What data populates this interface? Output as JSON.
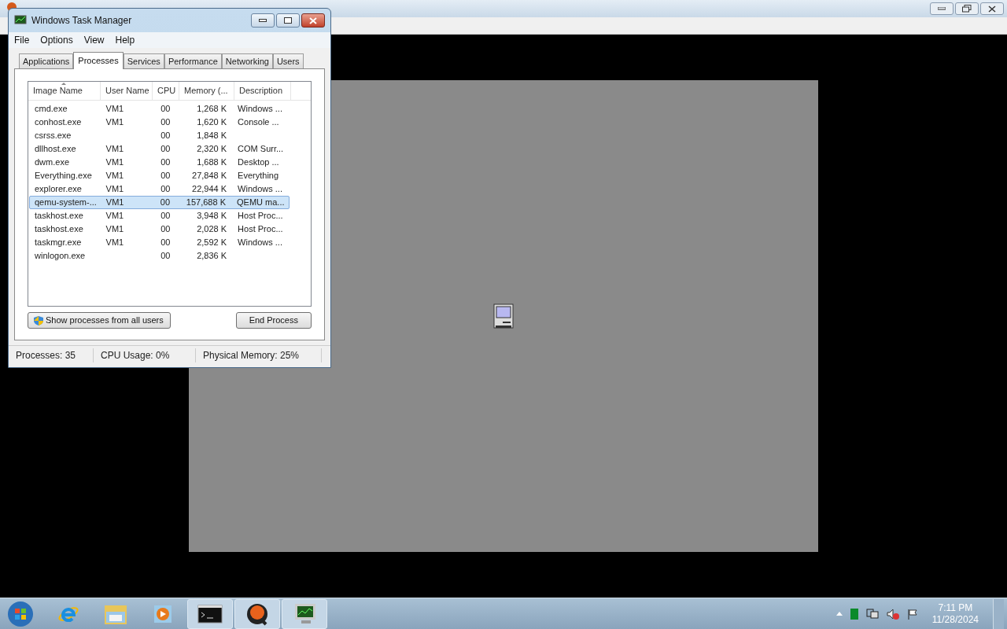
{
  "task_manager": {
    "title": "Windows Task Manager",
    "menu": [
      "File",
      "Options",
      "View",
      "Help"
    ],
    "tabs": [
      {
        "label": "Applications",
        "selected": false
      },
      {
        "label": "Processes",
        "selected": true
      },
      {
        "label": "Services",
        "selected": false
      },
      {
        "label": "Performance",
        "selected": false
      },
      {
        "label": "Networking",
        "selected": false
      },
      {
        "label": "Users",
        "selected": false
      }
    ],
    "columns": [
      "Image Name",
      "User Name",
      "CPU",
      "Memory (...",
      "Description"
    ],
    "rows": [
      {
        "cells": [
          "cmd.exe",
          "VM1",
          "00",
          "1,268 K",
          "Windows ..."
        ],
        "selected": false
      },
      {
        "cells": [
          "conhost.exe",
          "VM1",
          "00",
          "1,620 K",
          "Console ..."
        ],
        "selected": false
      },
      {
        "cells": [
          "csrss.exe",
          "",
          "00",
          "1,848 K",
          ""
        ],
        "selected": false
      },
      {
        "cells": [
          "dllhost.exe",
          "VM1",
          "00",
          "2,320 K",
          "COM Surr..."
        ],
        "selected": false
      },
      {
        "cells": [
          "dwm.exe",
          "VM1",
          "00",
          "1,688 K",
          "Desktop ..."
        ],
        "selected": false
      },
      {
        "cells": [
          "Everything.exe",
          "VM1",
          "00",
          "27,848 K",
          "Everything"
        ],
        "selected": false
      },
      {
        "cells": [
          "explorer.exe",
          "VM1",
          "00",
          "22,944 K",
          "Windows ..."
        ],
        "selected": false
      },
      {
        "cells": [
          "qemu-system-...",
          "VM1",
          "00",
          "157,688 K",
          "QEMU ma..."
        ],
        "selected": true
      },
      {
        "cells": [
          "taskhost.exe",
          "VM1",
          "00",
          "3,948 K",
          "Host Proc..."
        ],
        "selected": false
      },
      {
        "cells": [
          "taskhost.exe",
          "VM1",
          "00",
          "2,028 K",
          "Host Proc..."
        ],
        "selected": false
      },
      {
        "cells": [
          "taskmgr.exe",
          "VM1",
          "00",
          "2,592 K",
          "Windows ..."
        ],
        "selected": false
      },
      {
        "cells": [
          "winlogon.exe",
          "",
          "00",
          "2,836 K",
          ""
        ],
        "selected": false
      }
    ],
    "buttons": [
      {
        "kind": "shield",
        "label": "Show processes from all users"
      },
      {
        "kind": "plain",
        "label": "End Process"
      }
    ],
    "status_bar": [
      "Processes: 35",
      "CPU Usage: 0%",
      "Physical Memory: 25%"
    ]
  },
  "taskbar": {
    "apps": [
      {
        "kind": "ie",
        "running": false
      },
      {
        "kind": "folder",
        "running": false
      },
      {
        "kind": "media",
        "running": false
      },
      {
        "kind": "cmd",
        "running": true
      },
      {
        "kind": "qemu",
        "running": true
      },
      {
        "kind": "taskmgr",
        "running": true
      }
    ],
    "clock": {
      "time": "7:11 PM",
      "date": "11/28/2024"
    }
  }
}
